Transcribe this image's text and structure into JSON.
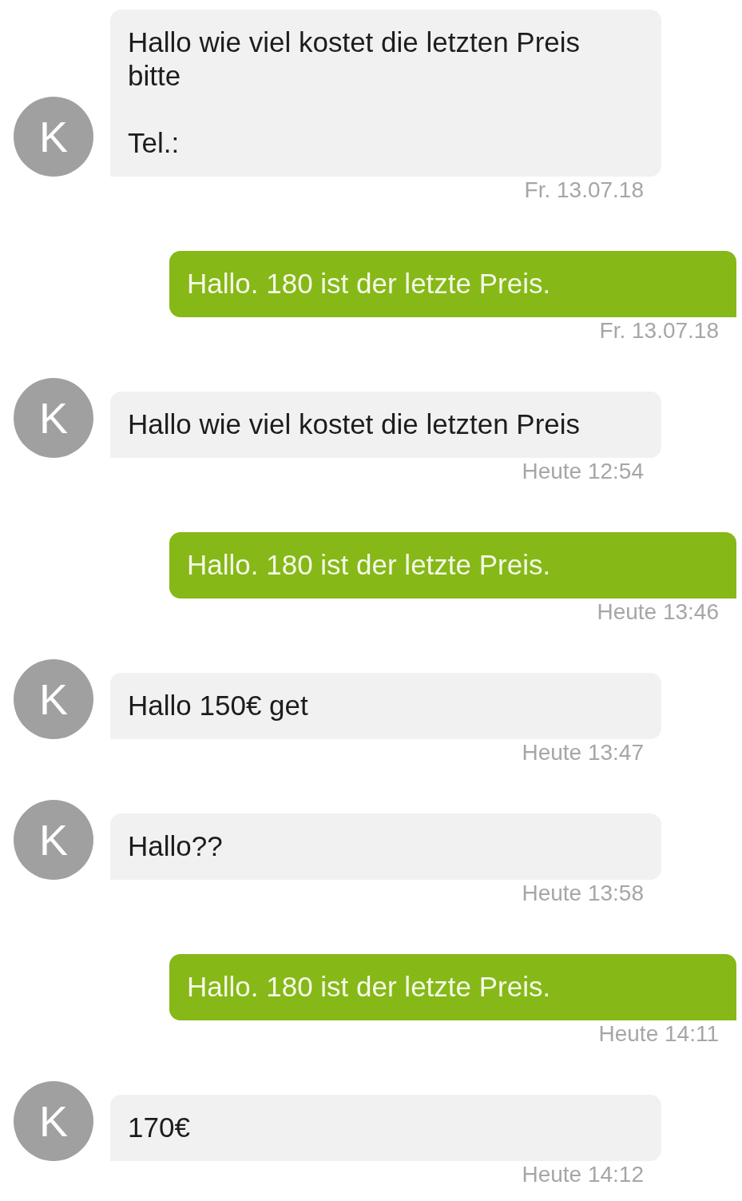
{
  "messages": [
    {
      "kind": "incoming",
      "sender_initial": "K",
      "text": "Hallo wie viel kostet die letzten Preis bitte\n\nTel.:",
      "time": "Fr. 13.07.18"
    },
    {
      "kind": "outgoing",
      "text": "Hallo. 180 ist der letzte Preis.",
      "time": "Fr. 13.07.18"
    },
    {
      "kind": "incoming",
      "sender_initial": "K",
      "text": "Hallo wie viel kostet die letzten Preis",
      "time": "Heute 12:54"
    },
    {
      "kind": "outgoing",
      "text": "Hallo. 180 ist der letzte Preis.",
      "time": "Heute 13:46"
    },
    {
      "kind": "incoming",
      "sender_initial": "K",
      "text": "Hallo 150€ get",
      "time": "Heute 13:47"
    },
    {
      "kind": "incoming",
      "sender_initial": "K",
      "text": "Hallo??",
      "time": "Heute 13:58"
    },
    {
      "kind": "outgoing",
      "text": "Hallo. 180 ist der letzte Preis.",
      "time": "Heute 14:11"
    },
    {
      "kind": "incoming",
      "sender_initial": "K",
      "text": "170€",
      "time": "Heute 14:12"
    }
  ]
}
